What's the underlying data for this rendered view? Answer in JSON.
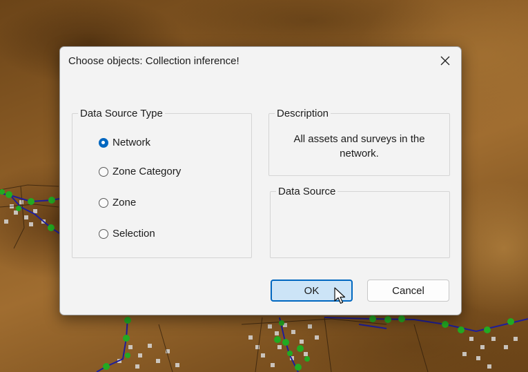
{
  "dialog": {
    "title": "Choose objects: Collection inference!",
    "close_label": "×"
  },
  "data_source_type": {
    "legend": "Data Source Type",
    "options": [
      {
        "label": "Network",
        "checked": true
      },
      {
        "label": "Zone Category",
        "checked": false
      },
      {
        "label": "Zone",
        "checked": false
      },
      {
        "label": "Selection",
        "checked": false
      }
    ]
  },
  "description": {
    "legend": "Description",
    "text": "All assets and surveys in the network."
  },
  "data_source": {
    "legend": "Data Source"
  },
  "buttons": {
    "ok_label": "OK",
    "cancel_label": "Cancel"
  },
  "colors": {
    "accent": "#0067c0",
    "ok_fill": "#cce4f7",
    "network_pipe": "#1e1e9a",
    "network_node": "#22aa22"
  }
}
